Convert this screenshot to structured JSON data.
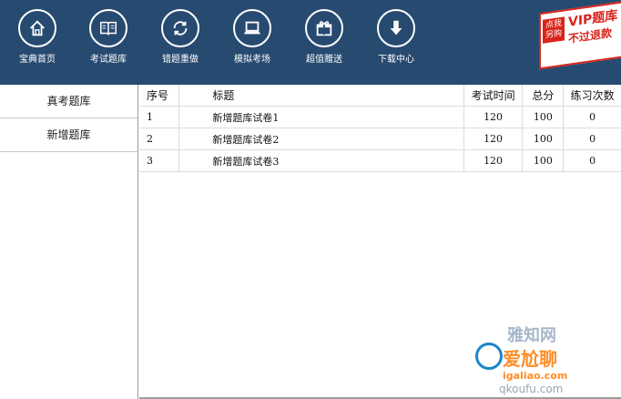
{
  "nav": [
    {
      "label": "宝典首页",
      "icon": "home-icon"
    },
    {
      "label": "考试题库",
      "icon": "book-icon"
    },
    {
      "label": "错题重做",
      "icon": "refresh-icon"
    },
    {
      "label": "模拟考场",
      "icon": "laptop-icon"
    },
    {
      "label": "超值赠送",
      "icon": "gift-icon"
    },
    {
      "label": "下载中心",
      "icon": "download-icon"
    }
  ],
  "promo": {
    "tag": "点我另购",
    "title": "VIP题库",
    "subtitle": "不过退款"
  },
  "sidebar": {
    "items": [
      {
        "label": "真考题库"
      },
      {
        "label": "新增题库"
      }
    ]
  },
  "table": {
    "headers": {
      "no": "序号",
      "title": "标题",
      "time": "考试时间",
      "score": "总分",
      "count": "练习次数"
    },
    "rows": [
      {
        "no": "1",
        "title": "新增题库试卷1",
        "time": "120",
        "score": "100",
        "count": "0"
      },
      {
        "no": "2",
        "title": "新增题库试卷2",
        "time": "120",
        "score": "100",
        "count": "0"
      },
      {
        "no": "3",
        "title": "新增题库试卷3",
        "time": "120",
        "score": "100",
        "count": "0"
      }
    ]
  },
  "watermark": {
    "line1": "雅知网",
    "line2": "爱尬聊",
    "url": "igaliao.com",
    "url2": "qkoufu.com"
  },
  "colors": {
    "topbar": "#274a70",
    "accent_red": "#d9241b"
  }
}
